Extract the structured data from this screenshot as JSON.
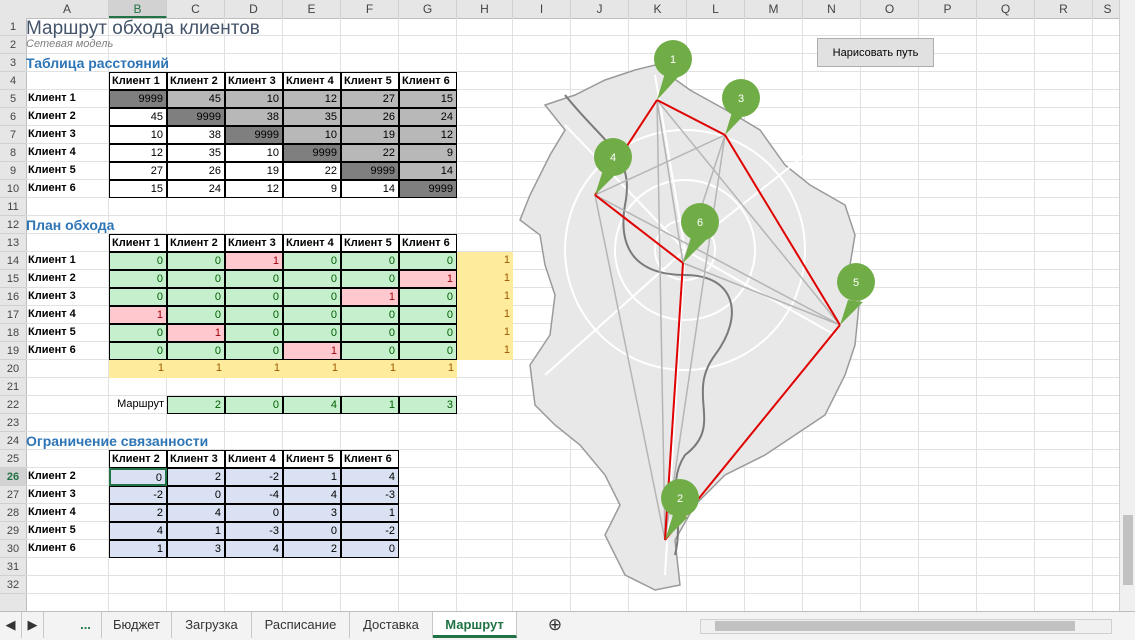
{
  "columns": [
    "A",
    "B",
    "C",
    "D",
    "E",
    "F",
    "G",
    "H",
    "I",
    "J",
    "K",
    "L",
    "M",
    "N",
    "O",
    "P",
    "Q",
    "R",
    "S"
  ],
  "rows": [
    "1",
    "2",
    "3",
    "4",
    "5",
    "6",
    "7",
    "8",
    "9",
    "10",
    "11",
    "12",
    "13",
    "14",
    "15",
    "16",
    "17",
    "18",
    "19",
    "20",
    "21",
    "22",
    "23",
    "24",
    "25",
    "26",
    "27",
    "28",
    "29",
    "30",
    "31",
    "32"
  ],
  "title": "Маршрут обхода клиентов",
  "subtitle": "Сетевая модель",
  "section_distances": "Таблица расстояний",
  "section_plan": "План обхода",
  "section_constraint": "Ограничение связанности",
  "clients": [
    "Клиент 1",
    "Клиент 2",
    "Клиент 3",
    "Клиент 4",
    "Клиент 5",
    "Клиент 6"
  ],
  "constraint_clients": [
    "Клиент 2",
    "Клиент 3",
    "Клиент 4",
    "Клиент 5",
    "Клиент 6"
  ],
  "distances": [
    [
      "9999",
      "45",
      "10",
      "12",
      "27",
      "15"
    ],
    [
      "45",
      "9999",
      "38",
      "35",
      "26",
      "24"
    ],
    [
      "10",
      "38",
      "9999",
      "10",
      "19",
      "12"
    ],
    [
      "12",
      "35",
      "10",
      "9999",
      "22",
      "9"
    ],
    [
      "27",
      "26",
      "19",
      "22",
      "9999",
      "14"
    ],
    [
      "15",
      "24",
      "12",
      "9",
      "14",
      "9999"
    ]
  ],
  "plan": [
    [
      "0",
      "0",
      "1",
      "0",
      "0",
      "0"
    ],
    [
      "0",
      "0",
      "0",
      "0",
      "0",
      "1"
    ],
    [
      "0",
      "0",
      "0",
      "0",
      "1",
      "0"
    ],
    [
      "1",
      "0",
      "0",
      "0",
      "0",
      "0"
    ],
    [
      "0",
      "1",
      "0",
      "0",
      "0",
      "0"
    ],
    [
      "0",
      "0",
      "0",
      "1",
      "0",
      "0"
    ]
  ],
  "plan_row_sums": [
    "1",
    "1",
    "1",
    "1",
    "1",
    "1"
  ],
  "plan_col_sums": [
    "1",
    "1",
    "1",
    "1",
    "1",
    "1"
  ],
  "route_label": "Маршрут",
  "route": [
    "2",
    "0",
    "4",
    "1",
    "3"
  ],
  "constraint": [
    [
      "0",
      "2",
      "-2",
      "1",
      "4"
    ],
    [
      "-2",
      "0",
      "-4",
      "4",
      "-3"
    ],
    [
      "2",
      "4",
      "0",
      "3",
      "1"
    ],
    [
      "4",
      "1",
      "-3",
      "0",
      "-2"
    ],
    [
      "1",
      "3",
      "4",
      "2",
      "0"
    ]
  ],
  "draw_button": "Нарисовать путь",
  "map_markers": [
    "1",
    "2",
    "3",
    "4",
    "5",
    "6"
  ],
  "tabs": [
    "Бюджет",
    "Загрузка",
    "Расписание",
    "Доставка",
    "Маршрут"
  ],
  "tab_ellipsis": "...",
  "active_tab": "Маршрут",
  "colors": {
    "accent": "#217346",
    "route_line": "#e00000",
    "marker": "#70ad47"
  }
}
